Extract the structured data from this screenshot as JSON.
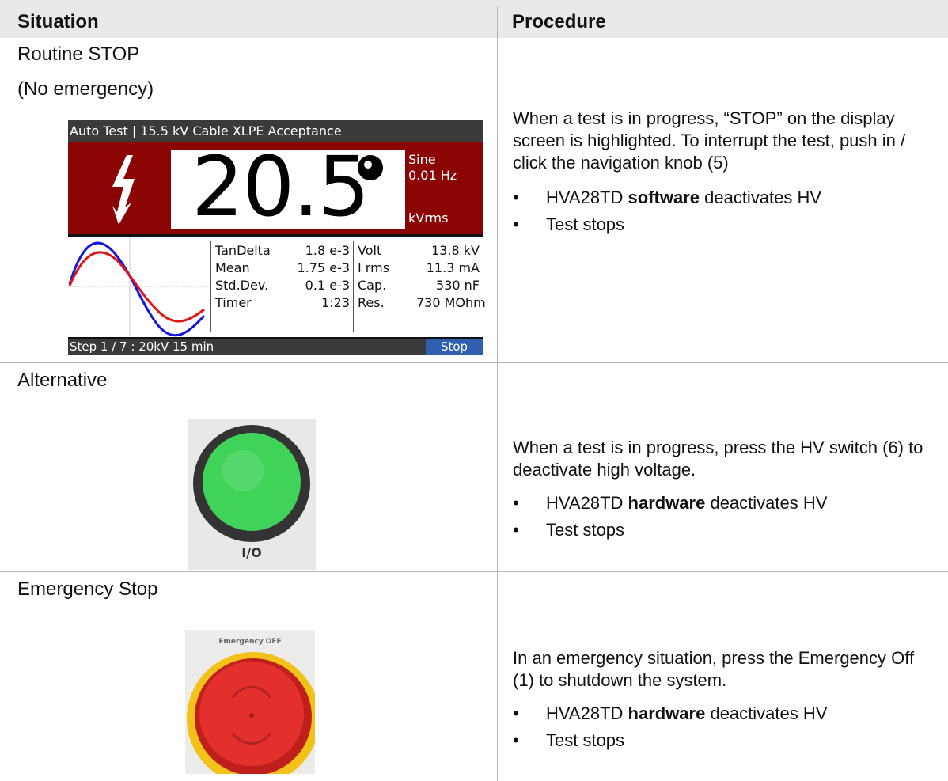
{
  "headers": {
    "situation": "Situation",
    "procedure": "Procedure"
  },
  "rows": [
    {
      "situation_line1": "Routine STOP",
      "situation_line2": "(No emergency)",
      "procedure_text": "When a test is in progress, “STOP” on the display screen is highlighted. To interrupt the test, push in / click the navigation knob (5)",
      "bullets": [
        {
          "pre": "HVA28TD ",
          "bold": "software",
          "post": " deactivates HV"
        },
        {
          "pre": "Test stops",
          "bold": "",
          "post": ""
        }
      ]
    },
    {
      "situation_line1": "Alternative",
      "procedure_text": "When a test is in progress, press the HV switch (6) to deactivate high voltage.",
      "bullets": [
        {
          "pre": "HVA28TD ",
          "bold": "hardware",
          "post": " deactivates HV"
        },
        {
          "pre": "Test stops",
          "bold": "",
          "post": ""
        }
      ]
    },
    {
      "situation_line1": "Emergency Stop",
      "procedure_text": "In an emergency situation, press the Emergency Off (1) to shutdown the system.",
      "bullets": [
        {
          "pre": "HVA28TD ",
          "bold": "hardware",
          "post": " deactivates HV"
        },
        {
          "pre": "Test stops",
          "bold": "",
          "post": ""
        }
      ]
    }
  ],
  "display": {
    "title": "Auto Test | 15.5 kV Cable XLPE Acceptance",
    "value": "20.5",
    "waveform": "Sine",
    "frequency": "0.01 Hz",
    "unit": "kVrms",
    "readings_left": [
      {
        "label": "TanDelta",
        "value": "1.8 e-3"
      },
      {
        "label": "Mean",
        "value": "1.75 e-3"
      },
      {
        "label": "Std.Dev.",
        "value": "0.1 e-3"
      },
      {
        "label": "Timer",
        "value": "1:23"
      }
    ],
    "readings_right": [
      {
        "label": "Volt",
        "value": "13.8 kV"
      },
      {
        "label": "I rms",
        "value": "11.3 mA"
      },
      {
        "label": "Cap.",
        "value": "530 nF"
      },
      {
        "label": "Res.",
        "value": "730 MOhm"
      }
    ],
    "status": "Step 1 / 7 : 20kV 15 min",
    "stop_label": "Stop",
    "colors": {
      "panel_red": "#8c0505",
      "bar_gray": "#3a3a3a",
      "stop_blue": "#2f5fb0",
      "wave_blue": "#1515e0",
      "wave_red": "#e01515"
    }
  },
  "hv_button": {
    "label": "I/O",
    "color": "#3fd35a"
  },
  "emergency_button": {
    "label": "Emergency OFF",
    "color": "#e4302c",
    "ring_color": "#f2c21a"
  }
}
